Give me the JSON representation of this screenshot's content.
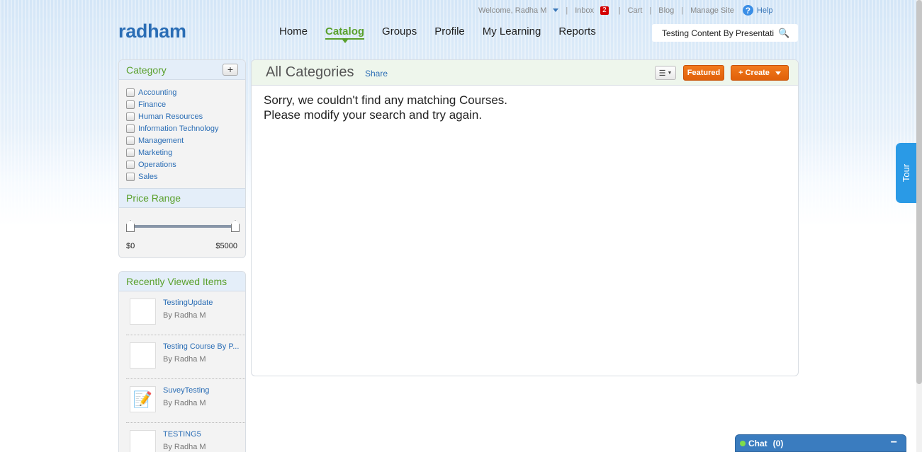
{
  "util": {
    "welcome": "Welcome, Radha M",
    "inbox": "Inbox",
    "inbox_count": "2",
    "cart": "Cart",
    "blog": "Blog",
    "manage_site": "Manage Site",
    "help": "Help"
  },
  "logo": "radham",
  "nav": {
    "home": "Home",
    "catalog": "Catalog",
    "groups": "Groups",
    "profile": "Profile",
    "my_learning": "My Learning",
    "reports": "Reports"
  },
  "search": {
    "value": "Testing Content By Presentati"
  },
  "category": {
    "title": "Category",
    "add": "+",
    "items": [
      "Accounting",
      "Finance",
      "Human Resources",
      "Information Technology",
      "Management",
      "Marketing",
      "Operations",
      "Sales"
    ]
  },
  "price_range": {
    "title": "Price Range",
    "min": "$0",
    "max": "$5000"
  },
  "recently_viewed": {
    "title": "Recently Viewed Items",
    "items": [
      {
        "title": "TestingUpdate",
        "by": "By Radha M"
      },
      {
        "title": "Testing Course By P...",
        "by": "By Radha M"
      },
      {
        "title": "SuveyTesting",
        "by": "By Radha M"
      },
      {
        "title": "TESTING5",
        "by": "By Radha M"
      }
    ]
  },
  "main": {
    "title": "All Categories",
    "share": "Share",
    "featured": "Featured",
    "create": "+ Create",
    "message_line1": "Sorry, we couldn't find any matching Courses.",
    "message_line2": "Please modify your search and try again."
  },
  "tour": "Tour",
  "chat": {
    "label": "Chat",
    "count": "(0)",
    "minimize": "−"
  },
  "colors": {
    "brand_blue": "#2a6db5",
    "accent_green": "#5aa02c",
    "button_orange": "#e0600a"
  }
}
